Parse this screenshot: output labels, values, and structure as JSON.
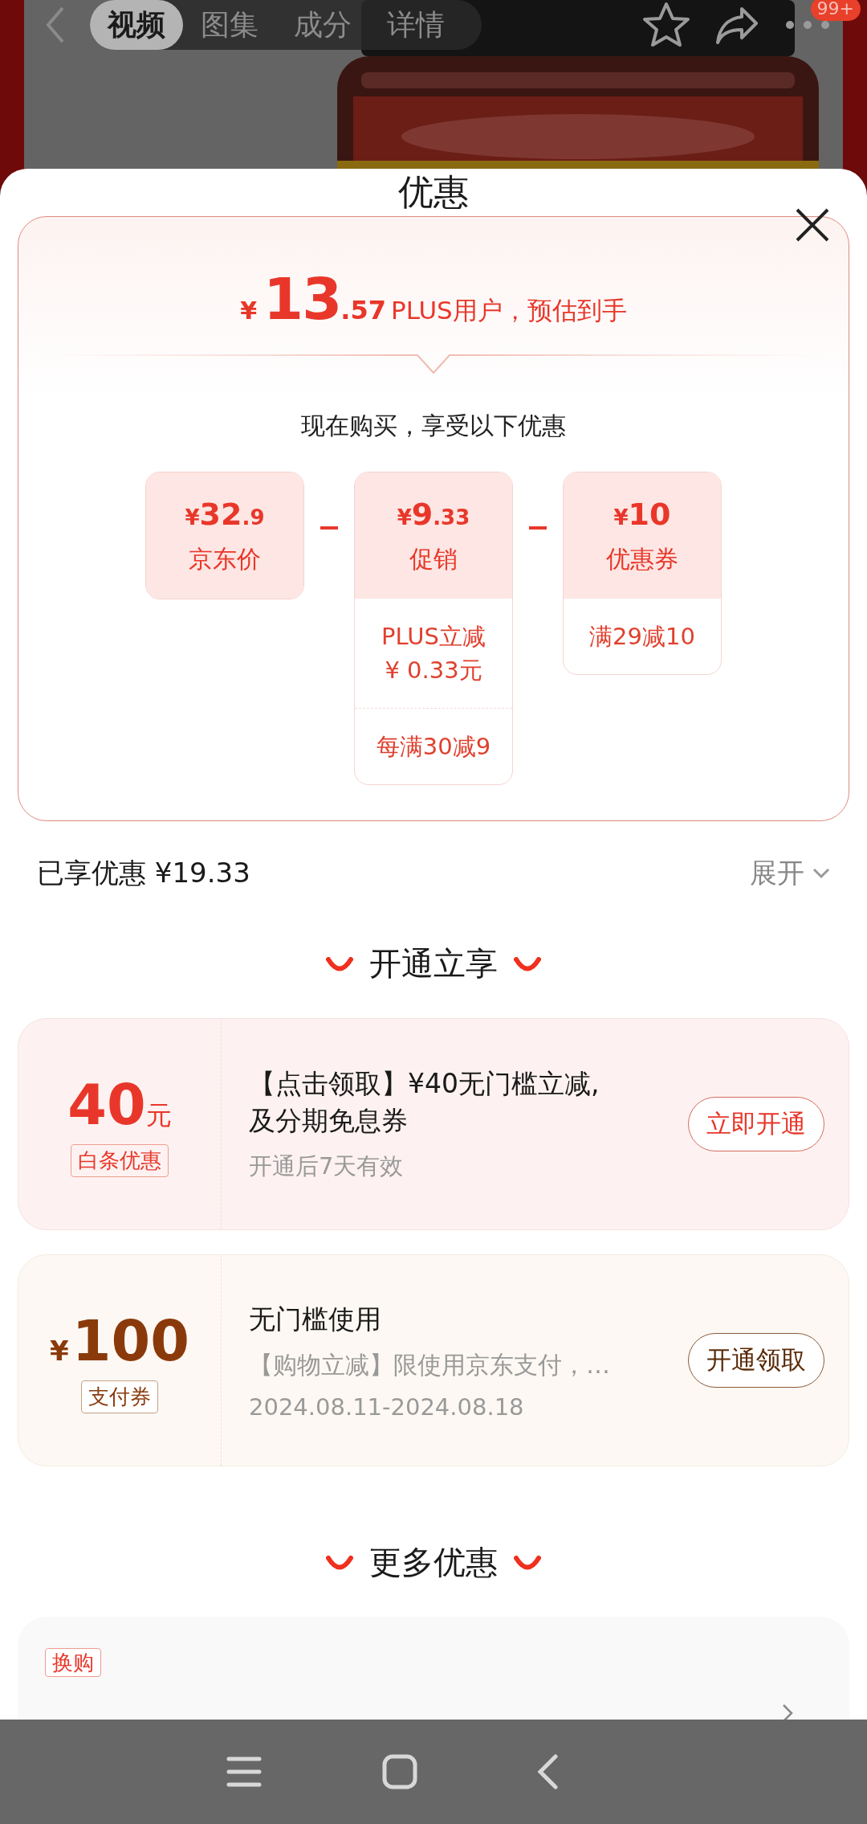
{
  "top_bar": {
    "tabs": [
      {
        "label": "视频",
        "selected": true
      },
      {
        "label": "图集",
        "selected": false
      },
      {
        "label": "成分",
        "selected": false
      },
      {
        "label": "详情",
        "selected": false
      }
    ],
    "badge": "99+"
  },
  "sheet": {
    "title": "优惠",
    "estimate": {
      "currency": "¥",
      "integer": "13",
      "decimal": ".57",
      "note": "PLUS用户，预估到手",
      "intro": "现在购买，享受以下优惠",
      "items": [
        {
          "currency": "¥",
          "integer": "32",
          "decimal": ".9",
          "label": "京东价"
        },
        {
          "currency": "¥",
          "integer": "9",
          "decimal": ".33",
          "label": "促销",
          "details": [
            "PLUS立减\n¥ 0.33元",
            "每满30减9"
          ]
        },
        {
          "currency": "¥",
          "integer": "10",
          "label": "优惠券",
          "details": [
            "满29减10"
          ]
        }
      ]
    },
    "savings": {
      "label": "已享优惠 ¥19.33",
      "toggle": "展开"
    },
    "sections": [
      {
        "heading": "开通立享",
        "cards": [
          {
            "kind": "credit",
            "amount": "40",
            "unit": "元",
            "tag": "白条优惠",
            "title": "【点击领取】¥40无门槛立减,及分期免息券",
            "subtitle": "开通后7天有效",
            "button": "立即开通"
          },
          {
            "kind": "payment",
            "currency": "¥",
            "amount": "100",
            "tag": "支付券",
            "title": "无门槛使用",
            "description": "【购物立减】限使用京东支付，…",
            "subtitle": "2024.08.11-2024.08.18",
            "button": "开通领取"
          }
        ]
      },
      {
        "heading": "更多优惠",
        "cards": [
          {
            "kind": "more",
            "tag": "换购"
          }
        ]
      }
    ]
  }
}
